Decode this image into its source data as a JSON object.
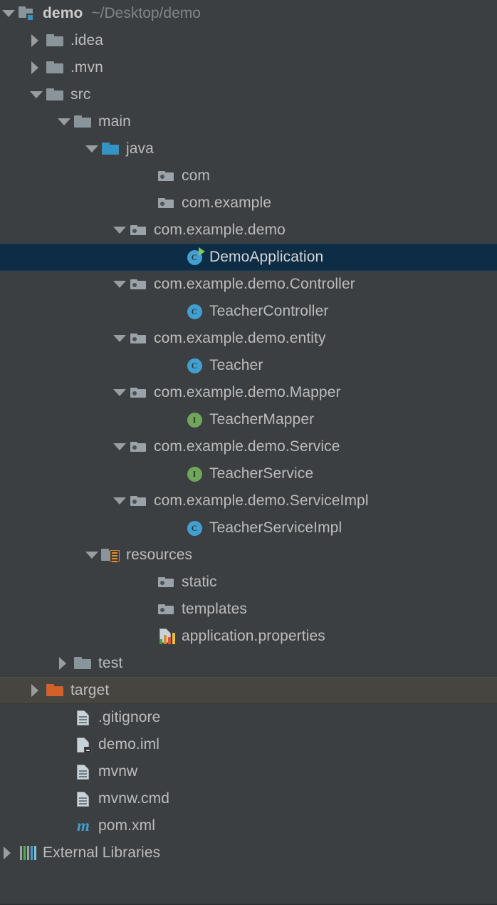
{
  "panel": {
    "name": "project-tool-window",
    "theme": {
      "background": "#3c3f41",
      "text": "#bcbcbc",
      "muted_text": "#81858a",
      "selection": "#0d2c45",
      "hover": "#474540",
      "source_root": "#3592c4",
      "excluded_folder": "#d2622a",
      "class_icon": "#439fd0",
      "interface_icon": "#6fa55c",
      "run_marker": "#7ec95a",
      "maven_icon": "#3f9ed4"
    }
  },
  "tree": {
    "rows": [
      {
        "label": "demo",
        "secondary": "~/Desktop/demo",
        "icon": "module-icon",
        "indent": 0,
        "twisty": "open",
        "bold": true,
        "state": "normal"
      },
      {
        "label": ".idea",
        "secondary": "",
        "icon": "folder-icon",
        "indent": 1,
        "twisty": "closed",
        "bold": false,
        "state": "normal"
      },
      {
        "label": ".mvn",
        "secondary": "",
        "icon": "folder-icon",
        "indent": 1,
        "twisty": "closed",
        "bold": false,
        "state": "normal"
      },
      {
        "label": "src",
        "secondary": "",
        "icon": "folder-icon",
        "indent": 1,
        "twisty": "open",
        "bold": false,
        "state": "normal"
      },
      {
        "label": "main",
        "secondary": "",
        "icon": "folder-icon",
        "indent": 2,
        "twisty": "open",
        "bold": false,
        "state": "normal"
      },
      {
        "label": "java",
        "secondary": "",
        "icon": "source-root-folder-icon",
        "indent": 3,
        "twisty": "open",
        "bold": false,
        "state": "normal"
      },
      {
        "label": "com",
        "secondary": "",
        "icon": "package-icon",
        "indent": 5,
        "twisty": "none",
        "bold": false,
        "state": "normal"
      },
      {
        "label": "com.example",
        "secondary": "",
        "icon": "package-icon",
        "indent": 5,
        "twisty": "none",
        "bold": false,
        "state": "normal"
      },
      {
        "label": "com.example.demo",
        "secondary": "",
        "icon": "package-icon",
        "indent": 4,
        "twisty": "open",
        "bold": false,
        "state": "normal"
      },
      {
        "label": "DemoApplication",
        "secondary": "",
        "icon": "java-class-runnable-icon",
        "indent": 6,
        "twisty": "none",
        "bold": false,
        "state": "selected"
      },
      {
        "label": "com.example.demo.Controller",
        "secondary": "",
        "icon": "package-icon",
        "indent": 4,
        "twisty": "open",
        "bold": false,
        "state": "normal"
      },
      {
        "label": "TeacherController",
        "secondary": "",
        "icon": "java-class-icon",
        "indent": 6,
        "twisty": "none",
        "bold": false,
        "state": "normal"
      },
      {
        "label": "com.example.demo.entity",
        "secondary": "",
        "icon": "package-icon",
        "indent": 4,
        "twisty": "open",
        "bold": false,
        "state": "normal"
      },
      {
        "label": "Teacher",
        "secondary": "",
        "icon": "java-class-icon",
        "indent": 6,
        "twisty": "none",
        "bold": false,
        "state": "normal"
      },
      {
        "label": "com.example.demo.Mapper",
        "secondary": "",
        "icon": "package-icon",
        "indent": 4,
        "twisty": "open",
        "bold": false,
        "state": "normal"
      },
      {
        "label": "TeacherMapper",
        "secondary": "",
        "icon": "java-interface-icon",
        "indent": 6,
        "twisty": "none",
        "bold": false,
        "state": "normal"
      },
      {
        "label": "com.example.demo.Service",
        "secondary": "",
        "icon": "package-icon",
        "indent": 4,
        "twisty": "open",
        "bold": false,
        "state": "normal"
      },
      {
        "label": "TeacherService",
        "secondary": "",
        "icon": "java-interface-icon",
        "indent": 6,
        "twisty": "none",
        "bold": false,
        "state": "normal"
      },
      {
        "label": "com.example.demo.ServiceImpl",
        "secondary": "",
        "icon": "package-icon",
        "indent": 4,
        "twisty": "open",
        "bold": false,
        "state": "normal"
      },
      {
        "label": "TeacherServiceImpl",
        "secondary": "",
        "icon": "java-class-icon",
        "indent": 6,
        "twisty": "none",
        "bold": false,
        "state": "normal"
      },
      {
        "label": "resources",
        "secondary": "",
        "icon": "resources-root-folder-icon",
        "indent": 3,
        "twisty": "open",
        "bold": false,
        "state": "normal"
      },
      {
        "label": "static",
        "secondary": "",
        "icon": "package-icon",
        "indent": 5,
        "twisty": "none",
        "bold": false,
        "state": "normal"
      },
      {
        "label": "templates",
        "secondary": "",
        "icon": "package-icon",
        "indent": 5,
        "twisty": "none",
        "bold": false,
        "state": "normal"
      },
      {
        "label": "application.properties",
        "secondary": "",
        "icon": "properties-file-icon",
        "indent": 5,
        "twisty": "none",
        "bold": false,
        "state": "normal"
      },
      {
        "label": "test",
        "secondary": "",
        "icon": "folder-icon",
        "indent": 2,
        "twisty": "closed",
        "bold": false,
        "state": "normal"
      },
      {
        "label": "target",
        "secondary": "",
        "icon": "excluded-folder-icon",
        "indent": 1,
        "twisty": "closed",
        "bold": false,
        "state": "hovered"
      },
      {
        "label": ".gitignore",
        "secondary": "",
        "icon": "file-icon",
        "indent": 2,
        "twisty": "none",
        "bold": false,
        "state": "normal"
      },
      {
        "label": "demo.iml",
        "secondary": "",
        "icon": "iml-file-icon",
        "indent": 2,
        "twisty": "none",
        "bold": false,
        "state": "normal"
      },
      {
        "label": "mvnw",
        "secondary": "",
        "icon": "file-icon",
        "indent": 2,
        "twisty": "none",
        "bold": false,
        "state": "normal"
      },
      {
        "label": "mvnw.cmd",
        "secondary": "",
        "icon": "file-icon",
        "indent": 2,
        "twisty": "none",
        "bold": false,
        "state": "normal"
      },
      {
        "label": "pom.xml",
        "secondary": "",
        "icon": "maven-pom-icon",
        "indent": 2,
        "twisty": "none",
        "bold": false,
        "state": "normal"
      },
      {
        "label": "External Libraries",
        "secondary": "",
        "icon": "external-libraries-icon",
        "indent": 0,
        "twisty": "closed",
        "bold": false,
        "state": "normal"
      }
    ]
  },
  "icon_colors": {
    "properties_bars": [
      "#4f9a4a",
      "#e08b2e",
      "#d9533a",
      "#e8c13c"
    ],
    "library_bars": [
      "#9aa6ad",
      "#5aa84f",
      "#9aa6ad",
      "#45a0c9",
      "#7fc2dd"
    ]
  }
}
